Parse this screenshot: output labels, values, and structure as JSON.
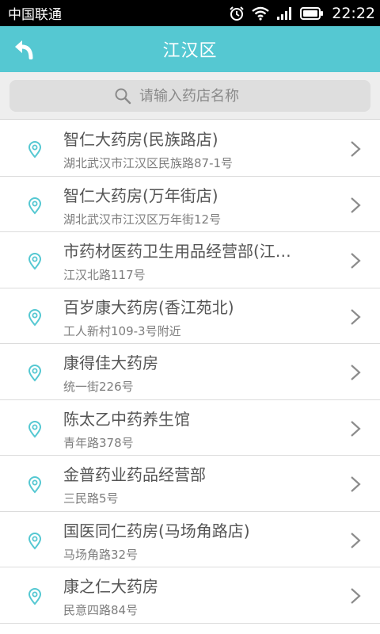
{
  "status_bar": {
    "carrier": "中国联通",
    "time": "22:22",
    "icons": [
      "alarm-icon",
      "wifi-icon",
      "signal-icon",
      "battery-icon"
    ]
  },
  "header": {
    "title": "江汉区",
    "back_icon": "back-arrow-icon"
  },
  "search": {
    "placeholder": "请输入药店名称",
    "icon": "search-icon"
  },
  "stores": [
    {
      "name": "智仁大药房(民族路店)",
      "address": "湖北武汉市江汉区民族路87-1号"
    },
    {
      "name": "智仁大药房(万年街店)",
      "address": "湖北武汉市江汉区万年街12号"
    },
    {
      "name": "市药材医药卫生用品经营部(江…",
      "address": "江汉北路117号"
    },
    {
      "name": "百岁康大药房(香江苑北)",
      "address": "工人新村109-3号附近"
    },
    {
      "name": "康得佳大药房",
      "address": "统一街226号"
    },
    {
      "name": "陈太乙中药养生馆",
      "address": "青年路378号"
    },
    {
      "name": "金普药业药品经营部",
      "address": "三民路5号"
    },
    {
      "name": "国医同仁药房(马场角路店)",
      "address": "马场角路32号"
    },
    {
      "name": "康之仁大药房",
      "address": "民意四路84号"
    }
  ],
  "colors": {
    "accent": "#55c8d2",
    "text_primary": "#555555",
    "text_secondary": "#7d7d7d"
  }
}
